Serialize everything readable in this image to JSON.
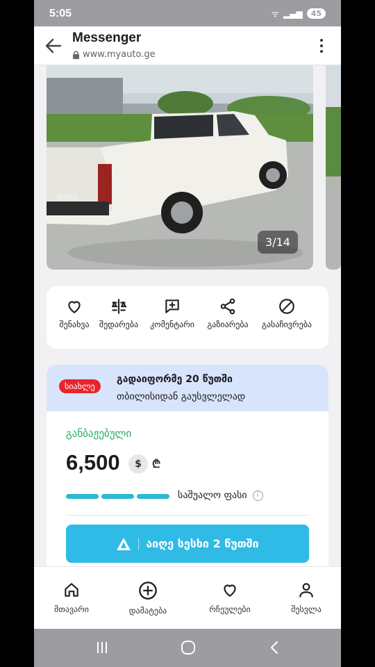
{
  "status_bar": {
    "time": "5:05",
    "battery": "45"
  },
  "app_bar": {
    "title": "Messenger",
    "url": "www.myauto.ge"
  },
  "gallery": {
    "counter": "3/14"
  },
  "actions": [
    {
      "label": "შენახვა",
      "icon": "heart-icon"
    },
    {
      "label": "შედარება",
      "icon": "compare-icon"
    },
    {
      "label": "კომენტარი",
      "icon": "comment-icon"
    },
    {
      "label": "გაზიარება",
      "icon": "share-icon"
    },
    {
      "label": "გასაჩივრება",
      "icon": "block-icon"
    }
  ],
  "promo": {
    "badge": "სიახლე",
    "line1": "გადაიფორმე 20 წუთში",
    "line2": "თბილისიდან გაუსვლელად"
  },
  "listing": {
    "status": "განბაჟებული",
    "price": "6,500",
    "currency_usd": "$",
    "currency_gel": "₾",
    "avg_label": "საშუალო ფასი",
    "cta_label": "აიღე სესხი 2 წუთში"
  },
  "bottom_nav": [
    {
      "label": "მთავარი",
      "icon": "home-icon"
    },
    {
      "label": "დამატება",
      "icon": "add-icon"
    },
    {
      "label": "რჩეულები",
      "icon": "heart-icon"
    },
    {
      "label": "შესვლა",
      "icon": "user-icon"
    }
  ],
  "colors": {
    "accent": "#2fbbe6",
    "badge": "#e8242f",
    "cleared": "#27ae60",
    "promo_bg": "#d8e4fb",
    "price_bar": "#2bbad0"
  }
}
